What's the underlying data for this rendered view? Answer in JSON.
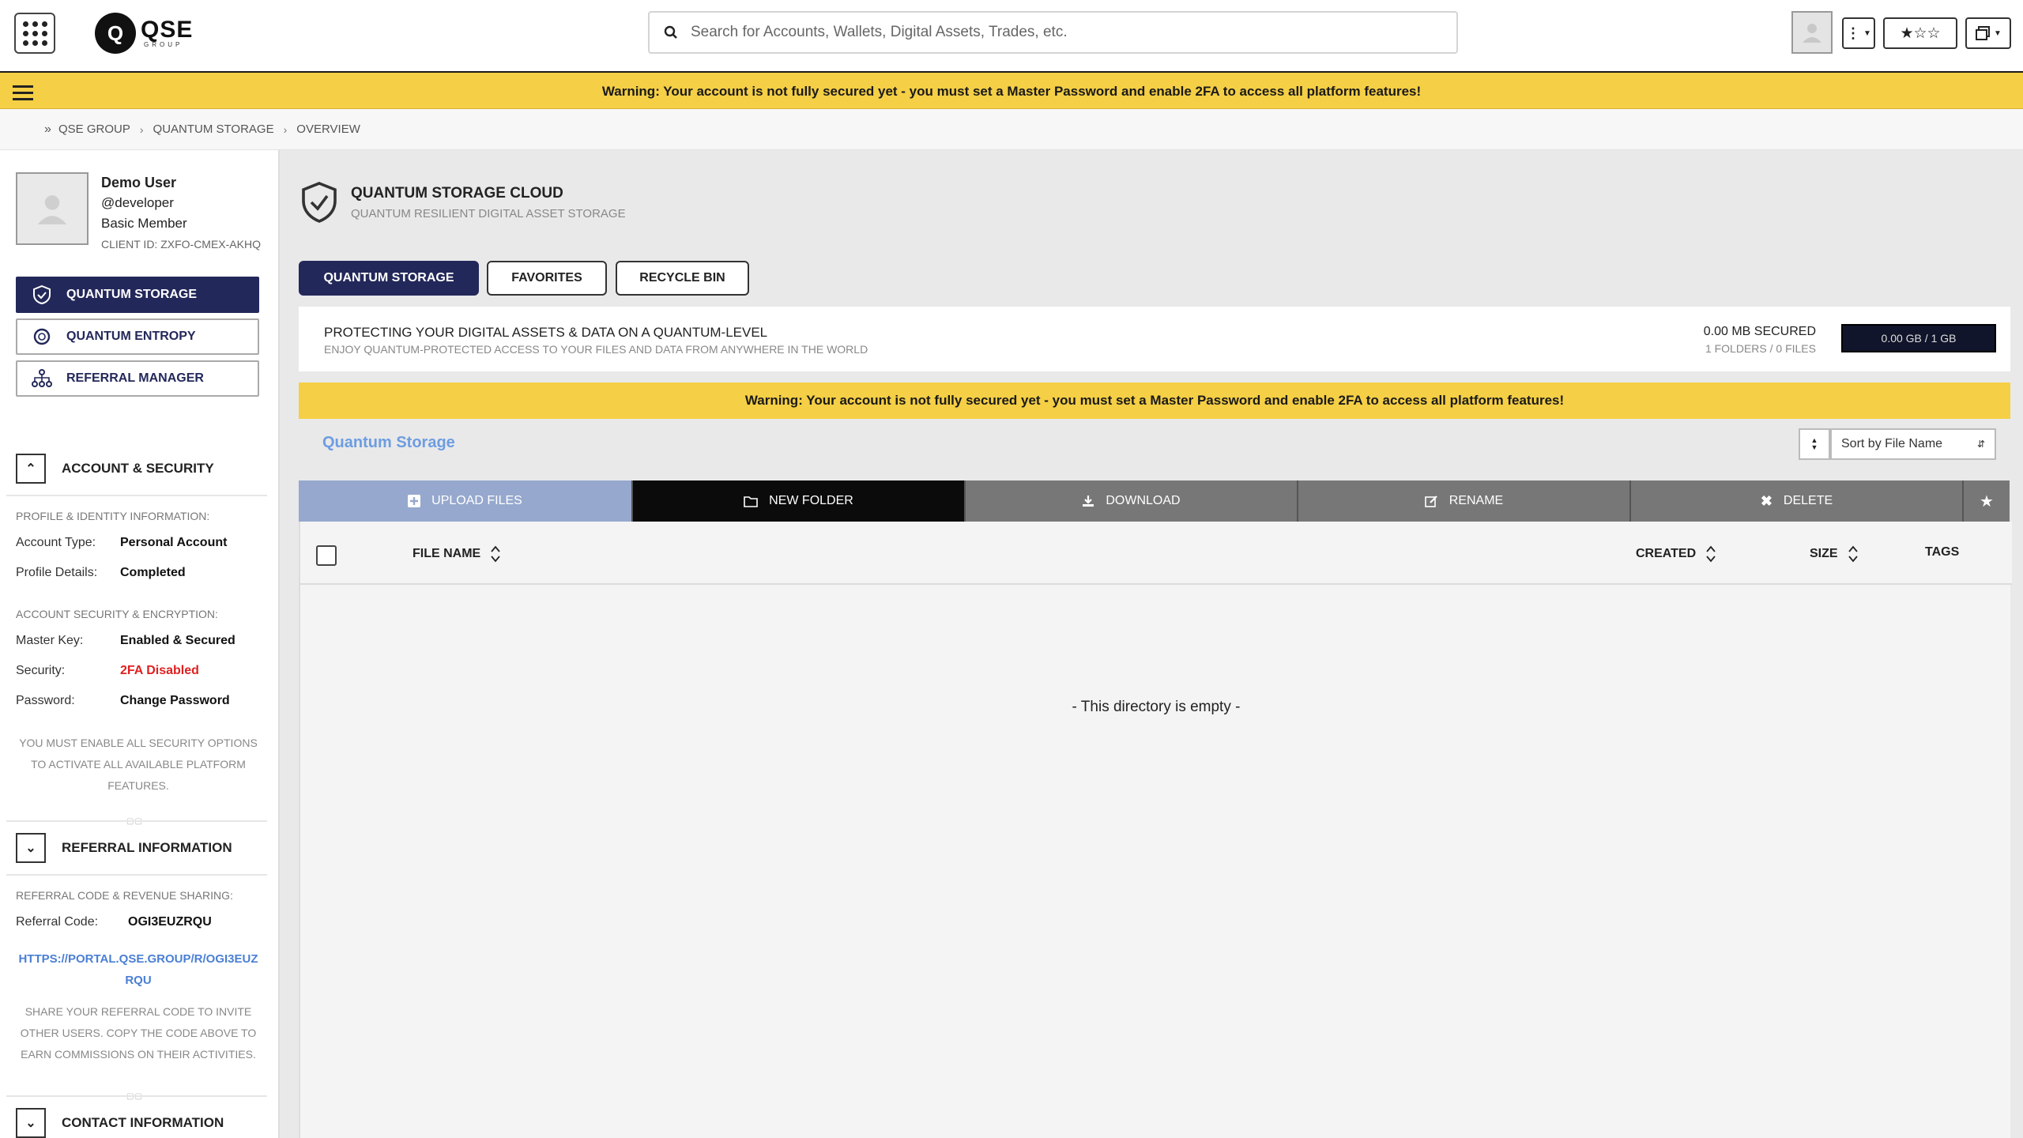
{
  "header": {
    "logo_text": "QSE",
    "logo_sub": "GROUP",
    "search_placeholder": "Search for Accounts, Wallets, Digital Assets, Trades, etc."
  },
  "warning": "Warning: Your account is not fully secured yet - you must set a Master Password and enable 2FA to access all platform features!",
  "breadcrumb": [
    "QSE GROUP",
    "QUANTUM STORAGE",
    "OVERVIEW"
  ],
  "profile": {
    "name": "Demo User",
    "handle": "@developer",
    "membership": "Basic Member",
    "client_id": "CLIENT ID: ZXFO-CMEX-AKHQ"
  },
  "nav": [
    {
      "label": "QUANTUM STORAGE",
      "icon": "shield-icon",
      "active": true
    },
    {
      "label": "QUANTUM ENTROPY",
      "icon": "entropy-icon",
      "active": false
    },
    {
      "label": "REFERRAL MANAGER",
      "icon": "network-icon",
      "active": false
    }
  ],
  "account": {
    "title": "ACCOUNT & SECURITY",
    "profile_label": "PROFILE & IDENTITY INFORMATION:",
    "account_type_k": "Account Type:",
    "account_type_v": "Personal Account",
    "profile_details_k": "Profile Details:",
    "profile_details_v": "Completed",
    "security_label": "ACCOUNT SECURITY & ENCRYPTION:",
    "master_key_k": "Master Key:",
    "master_key_v": "Enabled & Secured",
    "security_k": "Security:",
    "security_v": "2FA Disabled",
    "password_k": "Password:",
    "password_v": "Change Password",
    "note": "YOU MUST ENABLE ALL SECURITY OPTIONS TO ACTIVATE ALL AVAILABLE PLATFORM FEATURES."
  },
  "referral": {
    "title": "REFERRAL INFORMATION",
    "label": "REFERRAL CODE & REVENUE SHARING:",
    "code_k": "Referral Code:",
    "code_v": "OGI3EUZRQU",
    "link": "HTTPS://PORTAL.QSE.GROUP/R/OGI3EUZRQU",
    "note": "SHARE YOUR REFERRAL CODE TO INVITE OTHER USERS. COPY THE CODE ABOVE TO EARN COMMISSIONS ON THEIR ACTIVITIES."
  },
  "contact": {
    "title": "CONTACT INFORMATION"
  },
  "main": {
    "title": "QUANTUM STORAGE CLOUD",
    "subtitle": "QUANTUM RESILIENT DIGITAL ASSET STORAGE",
    "tabs": [
      "QUANTUM STORAGE",
      "FAVORITES",
      "RECYCLE BIN"
    ],
    "info_title": "PROTECTING YOUR DIGITAL ASSETS & DATA ON A QUANTUM-LEVEL",
    "info_sub": "ENJOY QUANTUM-PROTECTED ACCESS TO YOUR FILES AND DATA FROM ANYWHERE IN THE WORLD",
    "secured": "0.00 MB SECURED",
    "counts": "1 FOLDERS / 0 FILES",
    "usage": "0.00 GB / 1 GB",
    "usage_fraction": 0.0,
    "storage_title": "Quantum Storage",
    "sort_label": "Sort by File Name",
    "toolbar": [
      "UPLOAD FILES",
      "NEW FOLDER",
      "DOWNLOAD",
      "RENAME",
      "DELETE"
    ],
    "columns": [
      "FILE NAME",
      "CREATED",
      "SIZE",
      "TAGS"
    ],
    "empty": "- This directory is empty -"
  },
  "colors": {
    "navy": "#23285a",
    "warning": "#f5cf45",
    "link": "#4a7fd4",
    "danger": "#e02020"
  }
}
